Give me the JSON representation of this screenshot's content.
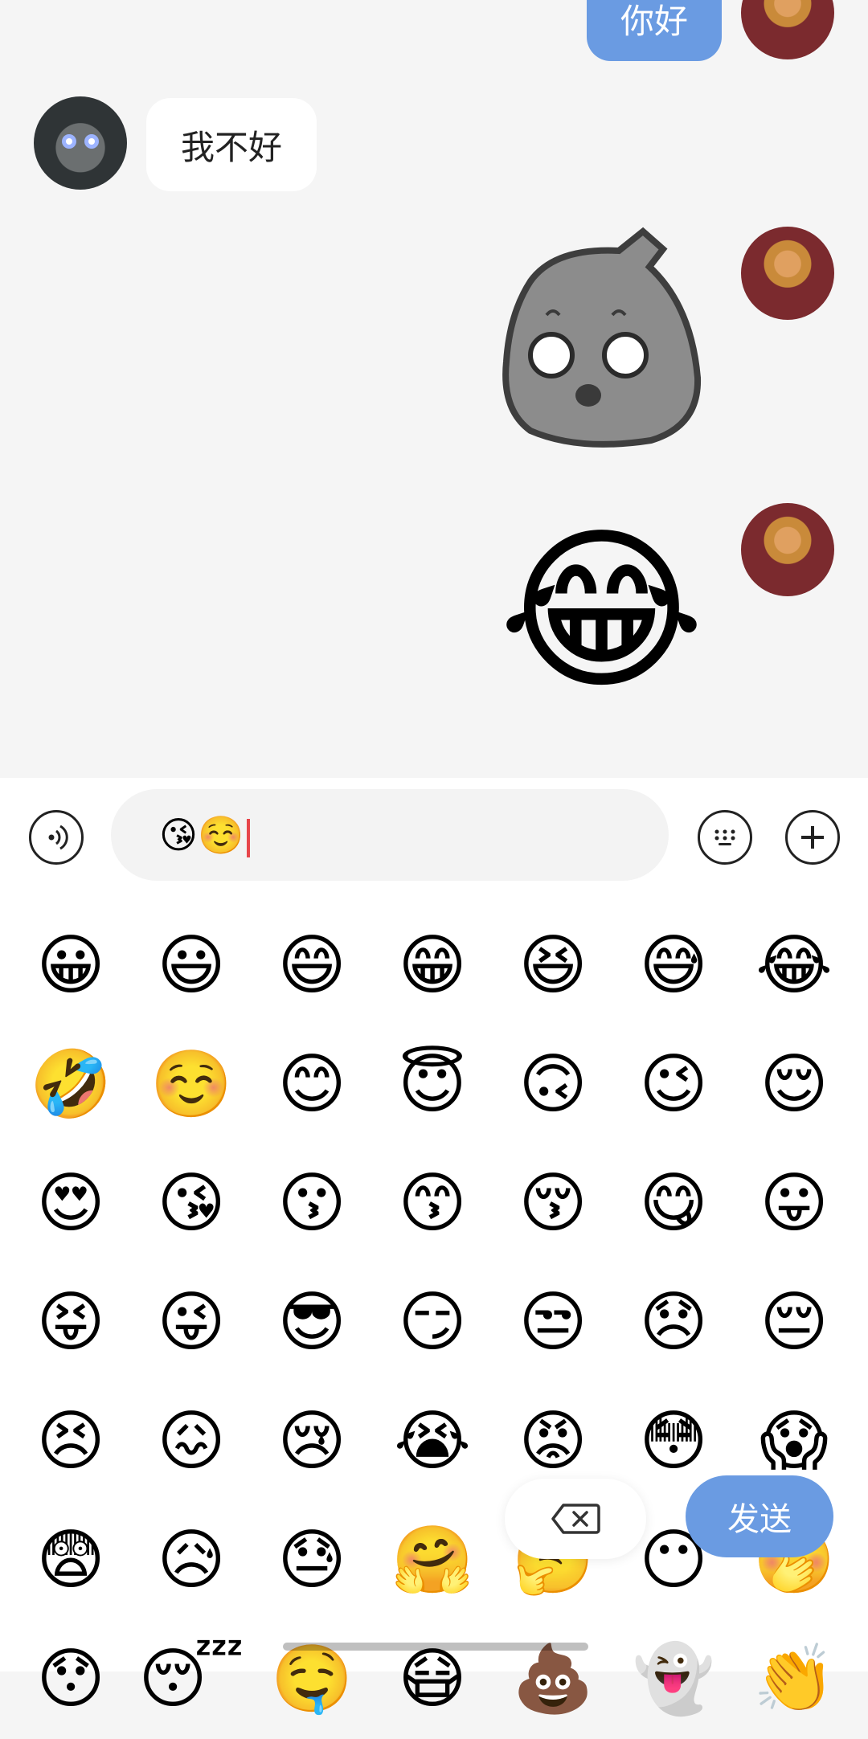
{
  "colors": {
    "accent": "#6a9be2",
    "caret": "#e7454a",
    "panel_bg": "#ffffff",
    "chat_bg": "#f5f5f5"
  },
  "messages": [
    {
      "side": "me",
      "type": "text",
      "text": "你好"
    },
    {
      "side": "other",
      "type": "text",
      "text": "我不好"
    },
    {
      "side": "me",
      "type": "sticker",
      "sticker": "gray-rock-sticker"
    },
    {
      "side": "me",
      "type": "emoji",
      "emoji": "😂"
    }
  ],
  "input": {
    "value": "😘☺️"
  },
  "icons": {
    "voice": "voice-icon",
    "emoji_keyboard": "keyboard-icon",
    "more": "plus-icon",
    "delete": "backspace-icon"
  },
  "emoji_grid": [
    "😀",
    "😃",
    "😄",
    "😁",
    "😆",
    "😅",
    "😂",
    "🤣",
    "☺️",
    "😊",
    "😇",
    "🙃",
    "😉",
    "😌",
    "😍",
    "😘",
    "😗",
    "😙",
    "😚",
    "😋",
    "😛",
    "😝",
    "😜",
    "😎",
    "😏",
    "😒",
    "😞",
    "😔",
    "😣",
    "😖",
    "😢",
    "😭",
    "😡",
    "😳",
    "😱",
    "😨",
    "😥",
    "😓",
    "🤗",
    "🤔",
    "😶",
    "🤭",
    "😯",
    "😴",
    "🤤",
    "😷",
    "💩",
    "👻",
    "👏"
  ],
  "send_button": {
    "label": "发送"
  }
}
